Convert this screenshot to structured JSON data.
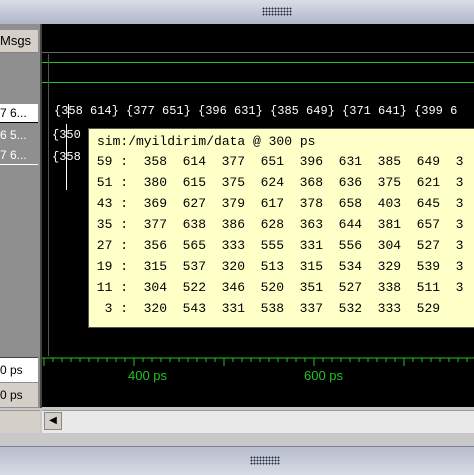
{
  "panes": {
    "names_header": "Msgs",
    "signals": [
      "7 6...",
      "6 5...",
      "7 6..."
    ],
    "now_label": "0 ps",
    "cursor_label": "0 ps"
  },
  "wave": {
    "bus_top": "{358 614} {377 651} {396 631} {385 649} {371 641} {399 6",
    "bus_mid": "{350",
    "bus_bot": "{358"
  },
  "tooltip": {
    "title": "sim:/myildirim/data @ 300 ps",
    "rows": [
      " 59 :  358  614  377  651  396  631  385  649  3",
      " 51 :  380  615  375  624  368  636  375  621  3",
      " 43 :  369  627  379  617  378  658  403  645  3",
      " 35 :  377  638  386  628  363  644  381  657  3",
      " 27 :  356  565  333  555  331  556  304  527  3",
      " 19 :  315  537  320  513  315  534  329  539  3",
      " 11 :  304  522  346  520  351  527  338  511  3",
      "  3 :  320  543  331  538  337  532  333  529"
    ]
  },
  "timeline": {
    "labels": [
      "400 ps",
      "600 ps"
    ]
  },
  "colors": {
    "wave_bg": "#000000",
    "signal_green": "#22c322",
    "tooltip_bg": "#ffffc8"
  }
}
